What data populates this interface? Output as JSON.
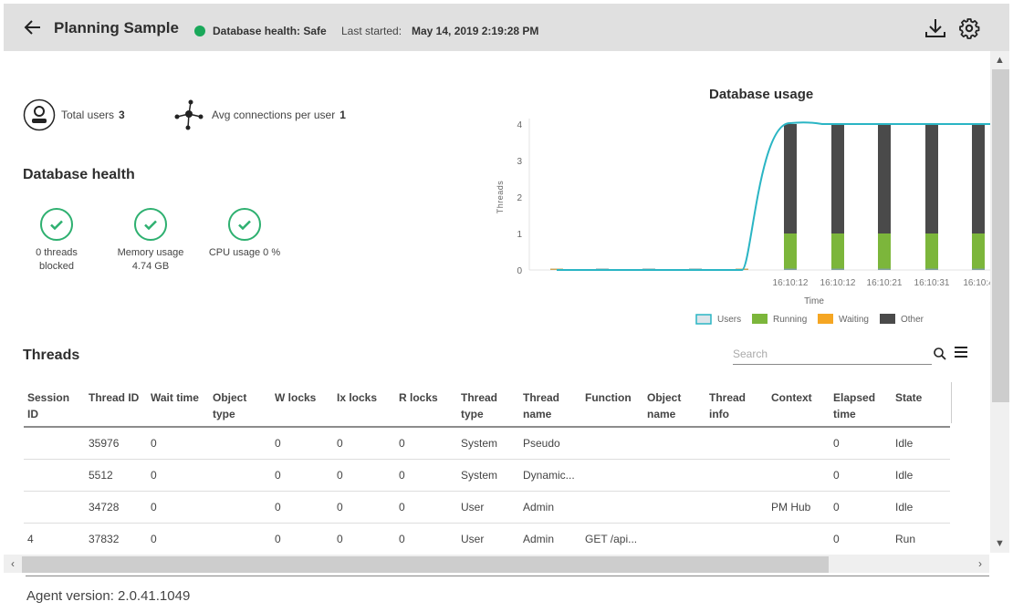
{
  "header": {
    "title": "Planning Sample",
    "health_status": "Database health: Safe",
    "health_color": "#1aa85a",
    "last_started_label": "Last started:",
    "last_started_value": "May 14, 2019 2:19:28 PM",
    "icons": {
      "back": "arrow-left-icon",
      "download": "download-icon",
      "settings": "gear-icon"
    }
  },
  "stats": {
    "total_users_label": "Total users",
    "total_users_value": "3",
    "avg_connections_label": "Avg connections per user",
    "avg_connections_value": "1"
  },
  "database_health": {
    "title": "Database health",
    "items": [
      {
        "line1": "0 threads",
        "line2": "blocked"
      },
      {
        "line1": "Memory usage",
        "line2": "4.74 GB"
      },
      {
        "line1": "CPU usage 0 %",
        "line2": ""
      }
    ],
    "check_color": "#2eb070"
  },
  "chart_data": {
    "type": "bar",
    "title": "Database usage",
    "xlabel": "Time",
    "ylabel": "Threads",
    "ylim": [
      0,
      4
    ],
    "yticks": [
      0,
      1,
      2,
      3,
      4
    ],
    "categories": [
      "",
      "",
      "",
      "",
      "",
      "16:10:12",
      "16:10:12",
      "16:10:21",
      "16:10:31",
      "16:10:4"
    ],
    "series": [
      {
        "name": "Running",
        "kind": "bar",
        "color": "#7cb63b",
        "values": [
          0,
          0,
          0,
          0,
          0,
          1,
          1,
          1,
          1,
          1
        ]
      },
      {
        "name": "Waiting",
        "kind": "bar",
        "color": "#f5a623",
        "values": [
          0,
          0,
          0,
          0,
          0,
          0,
          0,
          0,
          0,
          0
        ]
      },
      {
        "name": "Other",
        "kind": "bar",
        "color": "#4a4a4a",
        "values": [
          0,
          0,
          0,
          0,
          0,
          3,
          3,
          3,
          3,
          3
        ]
      },
      {
        "name": "Users",
        "kind": "line",
        "color": "#2ab5c4",
        "values": [
          0,
          0,
          0,
          0,
          0,
          4,
          4,
          4,
          4,
          4
        ]
      }
    ],
    "legend": [
      "Users",
      "Running",
      "Waiting",
      "Other"
    ],
    "legend_position": "bottom",
    "grid": false
  },
  "threads": {
    "title": "Threads",
    "search_placeholder": "Search",
    "columns": [
      [
        "Session",
        "ID"
      ],
      [
        "Thread ID",
        ""
      ],
      [
        "Wait time",
        ""
      ],
      [
        "Object",
        "type"
      ],
      [
        "W locks",
        ""
      ],
      [
        "Ix locks",
        ""
      ],
      [
        "R locks",
        ""
      ],
      [
        "Thread",
        "type"
      ],
      [
        "Thread",
        "name"
      ],
      [
        "Function",
        ""
      ],
      [
        "Object",
        "name"
      ],
      [
        "Thread",
        "info"
      ],
      [
        "Context",
        ""
      ],
      [
        "Elapsed",
        "time"
      ],
      [
        "State",
        ""
      ]
    ],
    "rows": [
      [
        "",
        "35976",
        "0",
        "",
        "0",
        "0",
        "0",
        "System",
        "Pseudo",
        "",
        "",
        "",
        "",
        "0",
        "Idle"
      ],
      [
        "",
        "5512",
        "0",
        "",
        "0",
        "0",
        "0",
        "System",
        "Dynamic...",
        "",
        "",
        "",
        "",
        "0",
        "Idle"
      ],
      [
        "",
        "34728",
        "0",
        "",
        "0",
        "0",
        "0",
        "User",
        "Admin",
        "",
        "",
        "",
        "PM Hub",
        "0",
        "Idle"
      ],
      [
        "4",
        "37832",
        "0",
        "",
        "0",
        "0",
        "0",
        "User",
        "Admin",
        "GET /api...",
        "",
        "",
        "",
        "0",
        "Run"
      ]
    ]
  },
  "footer": {
    "agent_version": "Agent version: 2.0.41.1049"
  }
}
